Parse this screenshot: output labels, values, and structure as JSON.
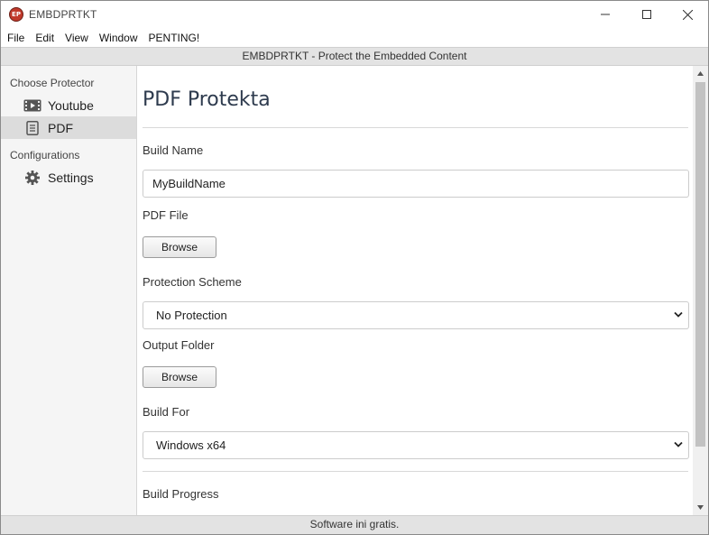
{
  "window": {
    "app_icon_text": "EP",
    "title": "EMBDPRTKT"
  },
  "menu": [
    "File",
    "Edit",
    "View",
    "Window",
    "PENTING!"
  ],
  "header": {
    "text": "EMBDPRTKT - Protect the Embedded Content"
  },
  "sidebar": {
    "section_protector": "Choose Protector",
    "items": [
      {
        "label": "Youtube",
        "icon": "video-icon"
      },
      {
        "label": "PDF",
        "icon": "document-icon"
      }
    ],
    "section_config": "Configurations",
    "settings_label": "Settings",
    "active_item": "PDF"
  },
  "main": {
    "title": "PDF Protekta",
    "build_name_label": "Build Name",
    "build_name_value": "MyBuildName",
    "pdf_file_label": "PDF File",
    "browse_label": "Browse",
    "protection_label": "Protection Scheme",
    "protection_value": "No Protection",
    "output_label": "Output Folder",
    "output_browse_label": "Browse",
    "build_for_label": "Build For",
    "build_for_value": "Windows x64",
    "progress_label": "Build Progress"
  },
  "status": {
    "text": "Software ini gratis."
  }
}
